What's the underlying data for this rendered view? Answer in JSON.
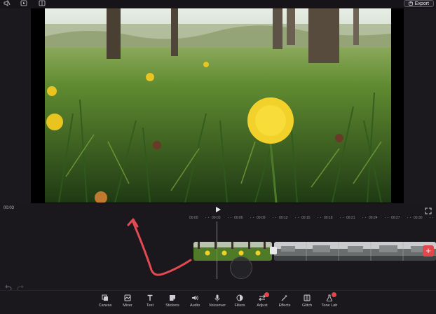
{
  "header": {
    "export_label": "Export",
    "icons": [
      "sound-off-icon",
      "add-media-icon",
      "layout-icon"
    ]
  },
  "player": {
    "current_time": "00:03"
  },
  "timeline": {
    "ruler_labels": [
      "00:00",
      "00:03",
      "00:06",
      "00:09",
      "00:12",
      "00:15",
      "00:18",
      "00:21",
      "00:24",
      "00:27",
      "00:30"
    ],
    "add_clip_symbol": "+"
  },
  "toolbar": {
    "items": [
      {
        "label": "Canvas",
        "icon": "canvas-icon",
        "badge": false
      },
      {
        "label": "Mixer",
        "icon": "mixer-icon",
        "badge": false
      },
      {
        "label": "Text",
        "icon": "text-icon",
        "badge": false
      },
      {
        "label": "Stickers",
        "icon": "stickers-icon",
        "badge": false
      },
      {
        "label": "Audio",
        "icon": "audio-icon",
        "badge": false
      },
      {
        "label": "Voiceover",
        "icon": "microphone-icon",
        "badge": false
      },
      {
        "label": "Filters",
        "icon": "filters-icon",
        "badge": false
      },
      {
        "label": "Adjust",
        "icon": "adjust-icon",
        "badge": true
      },
      {
        "label": "Effects",
        "icon": "effects-icon",
        "badge": false
      },
      {
        "label": "Glitch",
        "icon": "glitch-icon",
        "badge": false
      },
      {
        "label": "Tone Lab",
        "icon": "tone-lab-icon",
        "badge": true
      }
    ]
  },
  "colors": {
    "background": "#1a181d",
    "accent": "#e0484e",
    "playhead": "#e05a5a"
  }
}
